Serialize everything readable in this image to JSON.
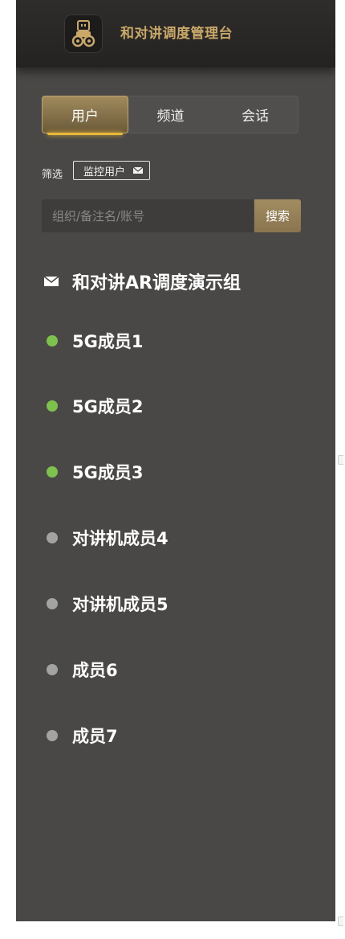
{
  "header": {
    "app_title": "和对讲调度管理台",
    "logo_icon": "walkie-robot-logo-icon"
  },
  "tabs": [
    {
      "label": "用户",
      "active": true
    },
    {
      "label": "频道",
      "active": false
    },
    {
      "label": "会话",
      "active": false
    }
  ],
  "filter": {
    "label": "筛选",
    "chip_label": "监控用户",
    "chip_icon": "envelope-icon"
  },
  "search": {
    "placeholder": "组织/备注名/账号",
    "value": "",
    "button_label": "搜索"
  },
  "group": {
    "name": "和对讲AR调度演示组",
    "icon": "envelope-icon"
  },
  "members": [
    {
      "name": "5G成员1",
      "status": "online"
    },
    {
      "name": "5G成员2",
      "status": "online"
    },
    {
      "name": "5G成员3",
      "status": "online"
    },
    {
      "name": "对讲机成员4",
      "status": "offline"
    },
    {
      "name": "对讲机成员5",
      "status": "offline"
    },
    {
      "name": "成员6",
      "status": "offline"
    },
    {
      "name": "成员7",
      "status": "offline"
    }
  ],
  "colors": {
    "panel_bg": "#4a4846",
    "accent_gold": "#c9a86a",
    "online": "#7ec14f",
    "offline": "#a3a3a3"
  }
}
